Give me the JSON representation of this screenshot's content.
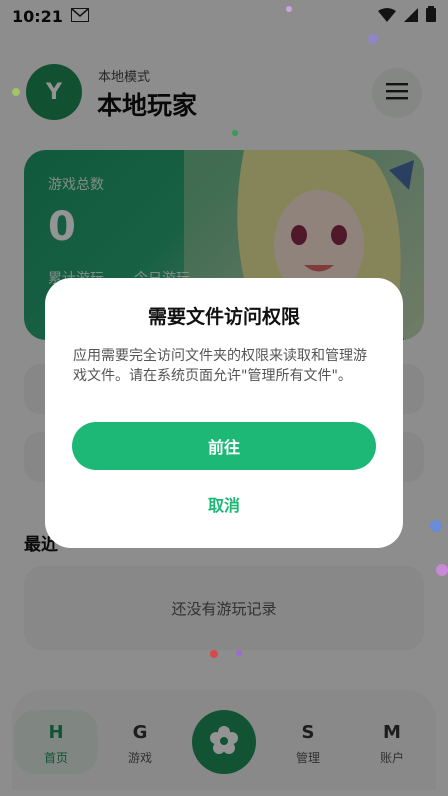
{
  "status_bar": {
    "time": "10:21"
  },
  "header": {
    "avatar_letter": "Y",
    "mode_label": "本地模式",
    "player_name": "本地玩家"
  },
  "hero": {
    "stat_label": "游戏总数",
    "stat_value": "0",
    "sub_label_1": "累计游玩",
    "sub_label_2": "今日游玩"
  },
  "recent": {
    "title": "最近",
    "empty_text": "还没有游玩记录"
  },
  "bottom_nav": {
    "items": [
      {
        "letter": "H",
        "label": "首页"
      },
      {
        "letter": "G",
        "label": "游戏"
      },
      {
        "letter": "S",
        "label": "管理"
      },
      {
        "letter": "M",
        "label": "账户"
      }
    ]
  },
  "dialog": {
    "title": "需要文件访问权限",
    "body": "应用需要完全访问文件夹的权限来读取和管理游戏文件。请在系统页面允许\"管理所有文件\"。",
    "primary_label": "前往",
    "secondary_label": "取消"
  },
  "colors": {
    "accent": "#1db876",
    "brand": "#1f8f5a"
  }
}
